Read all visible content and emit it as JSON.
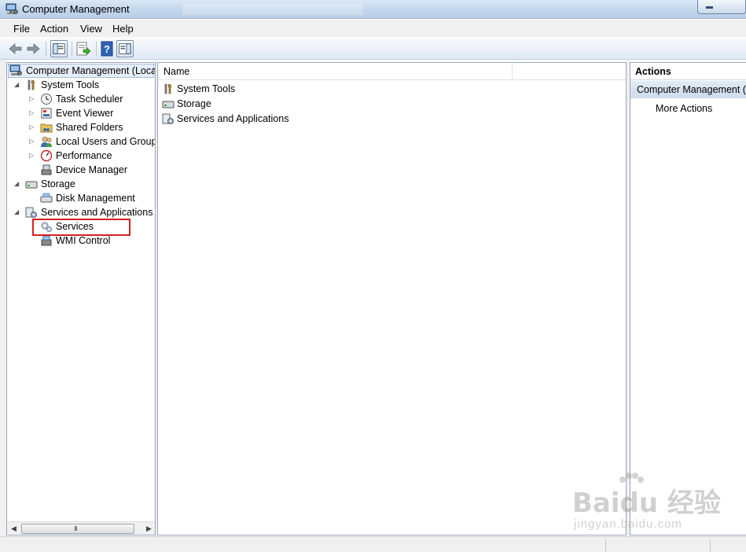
{
  "window": {
    "title": "Computer Management"
  },
  "menu": {
    "items": [
      "File",
      "Action",
      "View",
      "Help"
    ]
  },
  "toolbar": {
    "buttons": [
      "back-arrow-icon",
      "forward-arrow-icon",
      "show-hide-tree-icon",
      "export-list-icon",
      "help-icon",
      "show-hide-action-pane-icon"
    ]
  },
  "tree": {
    "root": "Computer Management (Local",
    "system_tools": "System Tools",
    "task_scheduler": "Task Scheduler",
    "event_viewer": "Event Viewer",
    "shared_folders": "Shared Folders",
    "local_users_groups": "Local Users and Groups",
    "performance": "Performance",
    "device_manager": "Device Manager",
    "storage": "Storage",
    "disk_management": "Disk Management",
    "services_apps": "Services and Applications",
    "services": "Services",
    "wmi_control": "WMI Control",
    "expand_glyph": "▷",
    "collapse_glyph": "◢",
    "scroll_grip": "III"
  },
  "list": {
    "column_name": "Name",
    "rows": [
      "System Tools",
      "Storage",
      "Services and Applications"
    ]
  },
  "actions": {
    "header": "Actions",
    "section": "Computer Management (L",
    "more_actions": "More Actions"
  },
  "watermark": {
    "brand": "Baidu 经验",
    "url": "jingyan.baidu.com"
  },
  "colors": {
    "highlight_box": "#d42020",
    "action_section_bg": "#d5e1f0"
  }
}
